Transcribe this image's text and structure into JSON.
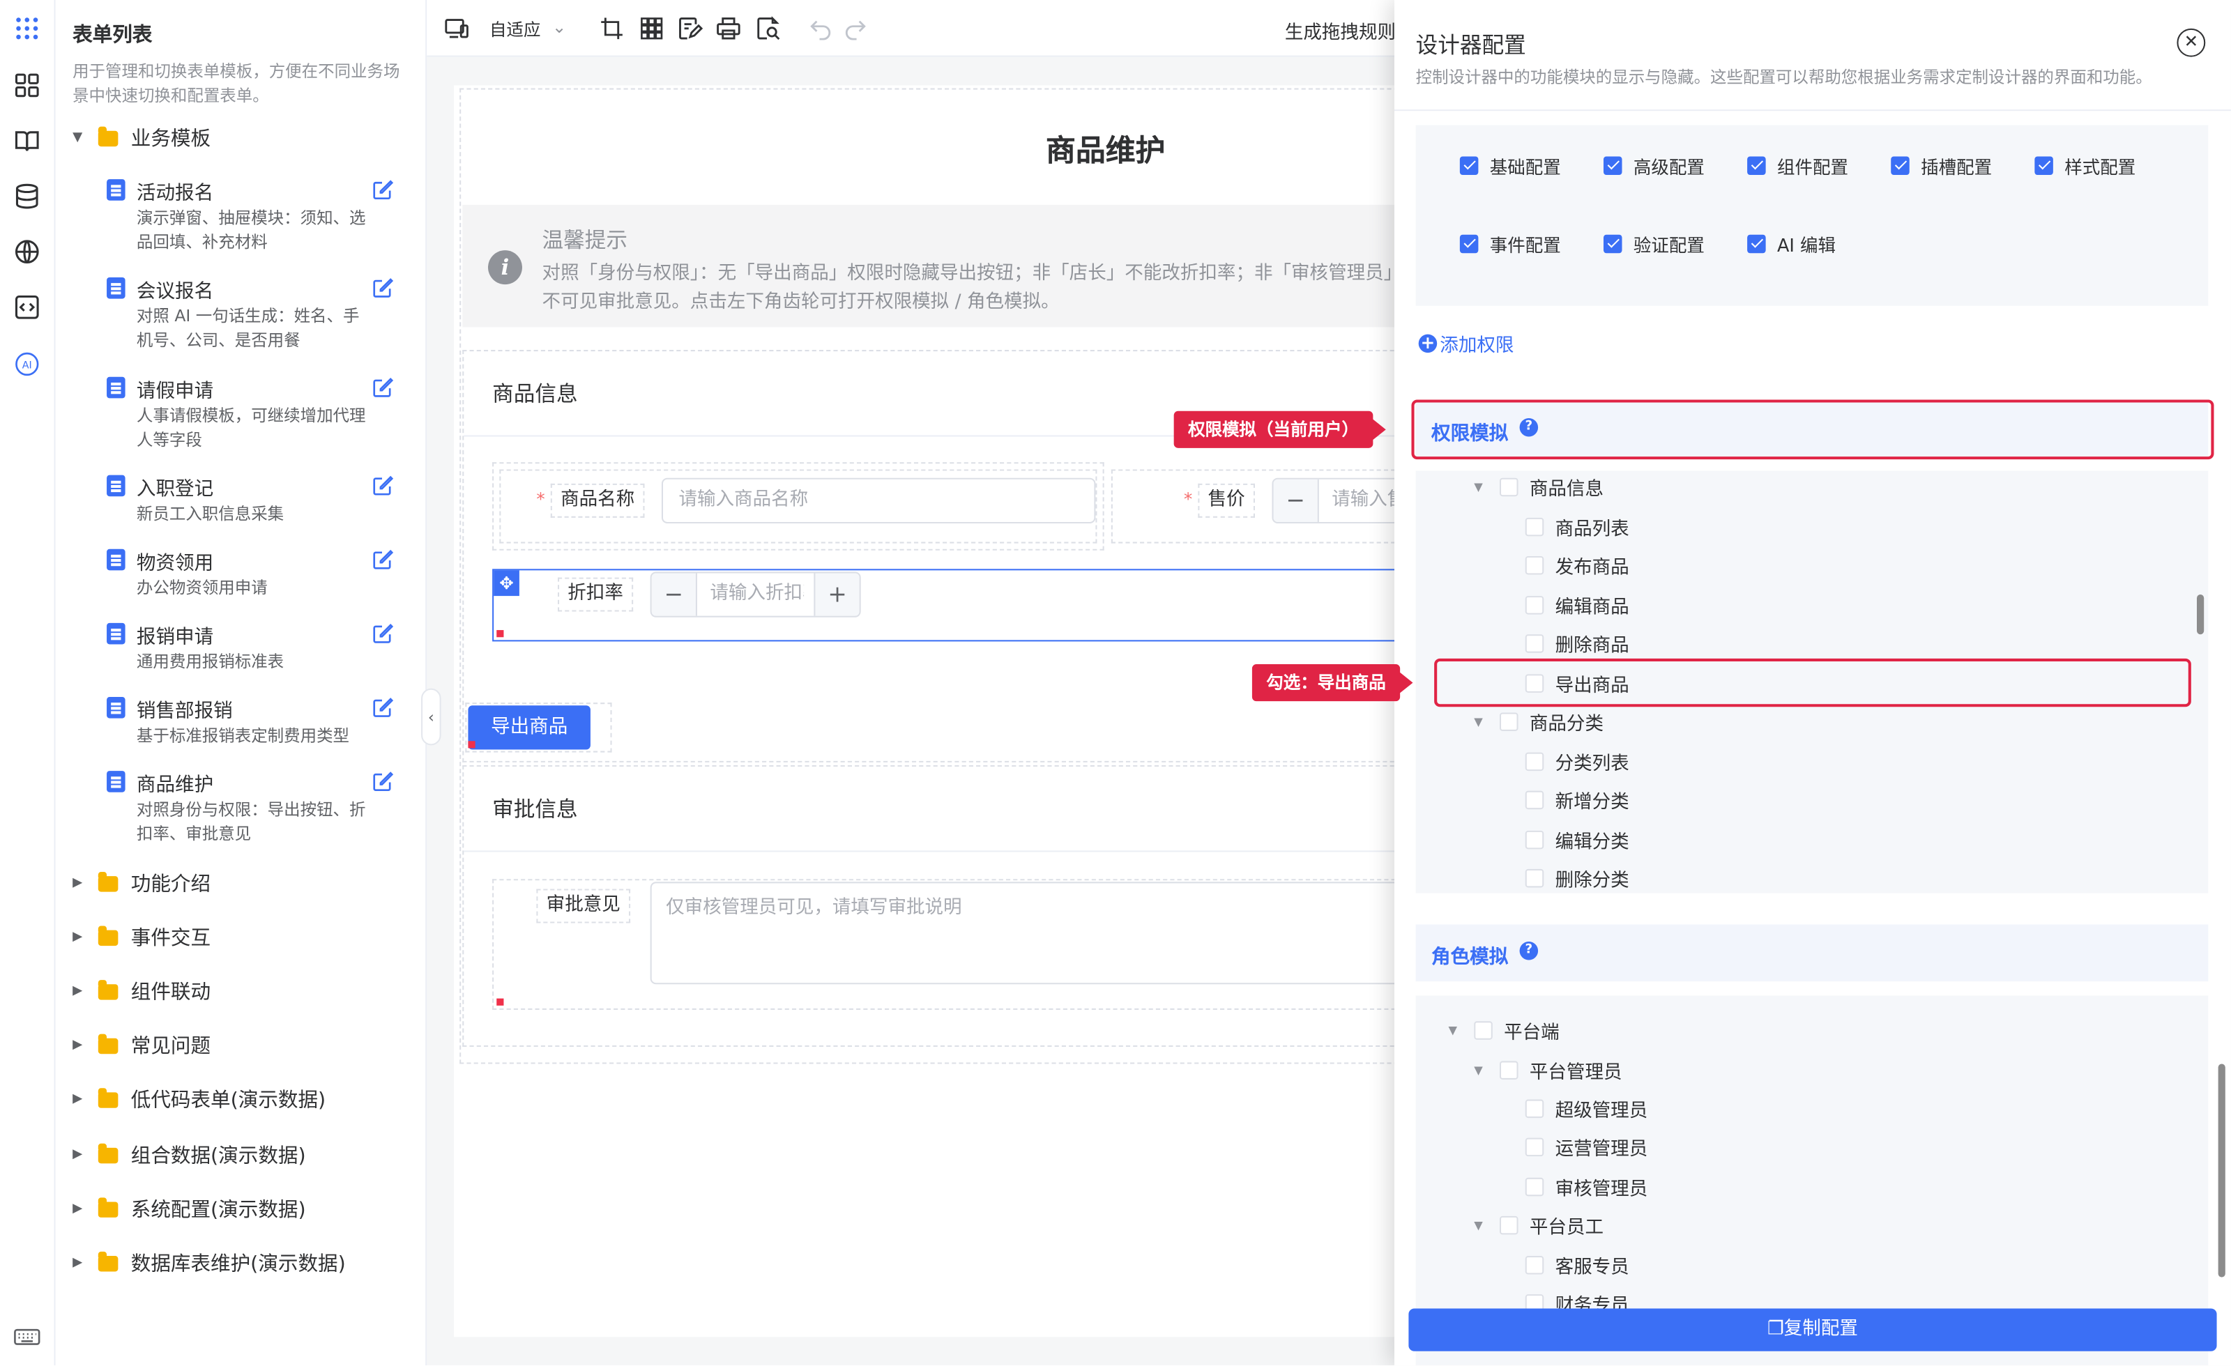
{
  "sidebar": {
    "title": "表单列表",
    "desc": "用于管理和切换表单模板，方便在不同业务场景中快速切换和配置表单。",
    "group_open": "业务模板",
    "items": [
      {
        "title": "活动报名",
        "desc": "演示弹窗、抽屉模块：须知、选品回填、补充材料"
      },
      {
        "title": "会议报名",
        "desc": "对照 AI 一句话生成：姓名、手机号、公司、是否用餐"
      },
      {
        "title": "请假申请",
        "desc": "人事请假模板，可继续增加代理人等字段"
      },
      {
        "title": "入职登记",
        "desc": "新员工入职信息采集"
      },
      {
        "title": "物资领用",
        "desc": "办公物资领用申请"
      },
      {
        "title": "报销申请",
        "desc": "通用费用报销标准表"
      },
      {
        "title": "销售部报销",
        "desc": "基于标准报销表定制费用类型"
      },
      {
        "title": "商品维护",
        "desc": "对照身份与权限：导出按钮、折扣率、审批意见"
      }
    ],
    "groups": [
      "功能介绍",
      "事件交互",
      "组件联动",
      "常见问题",
      "低代码表单(演示数据)",
      "组合数据(演示数据)",
      "系统配置(演示数据)",
      "数据库表维护(演示数据)"
    ]
  },
  "toolbar": {
    "mode": "自适应",
    "generate": "生成拖拽规则"
  },
  "form": {
    "title": "商品维护",
    "tip_title": "温馨提示",
    "tip_text": "对照「身份与权限」：无「导出商品」权限时隐藏导出按钮；非「店长」不能改折扣率；非「审核管理员」不可见审批意见。点击左下角齿轮可打开权限模拟 / 角色模拟。",
    "section1": "商品信息",
    "name_label": "商品名称",
    "name_placeholder": "请输入商品名称",
    "price_label": "售价",
    "price_placeholder": "请输入售价",
    "discount_label": "折扣率",
    "discount_placeholder": "请输入折扣率",
    "export_button": "导出商品",
    "section2": "审批信息",
    "approval_label": "审批意见",
    "approval_placeholder": "仅审核管理员可见，请填写审批说明"
  },
  "callouts": {
    "perm": "权限模拟（当前用户）",
    "check": "勾选：导出商品"
  },
  "panel": {
    "title": "设计器配置",
    "desc": "控制设计器中的功能模块的显示与隐藏。这些配置可以帮助您根据业务需求定制设计器的界面和功能。",
    "options_row1": [
      "基础配置",
      "高级配置",
      "组件配置",
      "插槽配置",
      "样式配置"
    ],
    "options_row2": [
      "事件配置",
      "验证配置",
      "AI 编辑"
    ],
    "add_permission": "添加权限",
    "perm_section": "权限模拟",
    "perm_tree": {
      "group1": "商品信息",
      "group1_items": [
        "商品列表",
        "发布商品",
        "编辑商品",
        "删除商品",
        "导出商品"
      ],
      "group2": "商品分类",
      "group2_items": [
        "分类列表",
        "新增分类",
        "编辑分类",
        "删除分类"
      ]
    },
    "role_section": "角色模拟",
    "role_tree": {
      "root": "平台端",
      "sub1": "平台管理员",
      "sub1_items": [
        "超级管理员",
        "运营管理员",
        "审核管理员"
      ],
      "sub2": "平台员工",
      "sub2_items": [
        "客服专员",
        "财务专员"
      ]
    },
    "copy_button": "复制配置"
  },
  "colors": {
    "primary": "#3b6ff5",
    "callout": "#e02445",
    "folder": "#f7b500"
  }
}
